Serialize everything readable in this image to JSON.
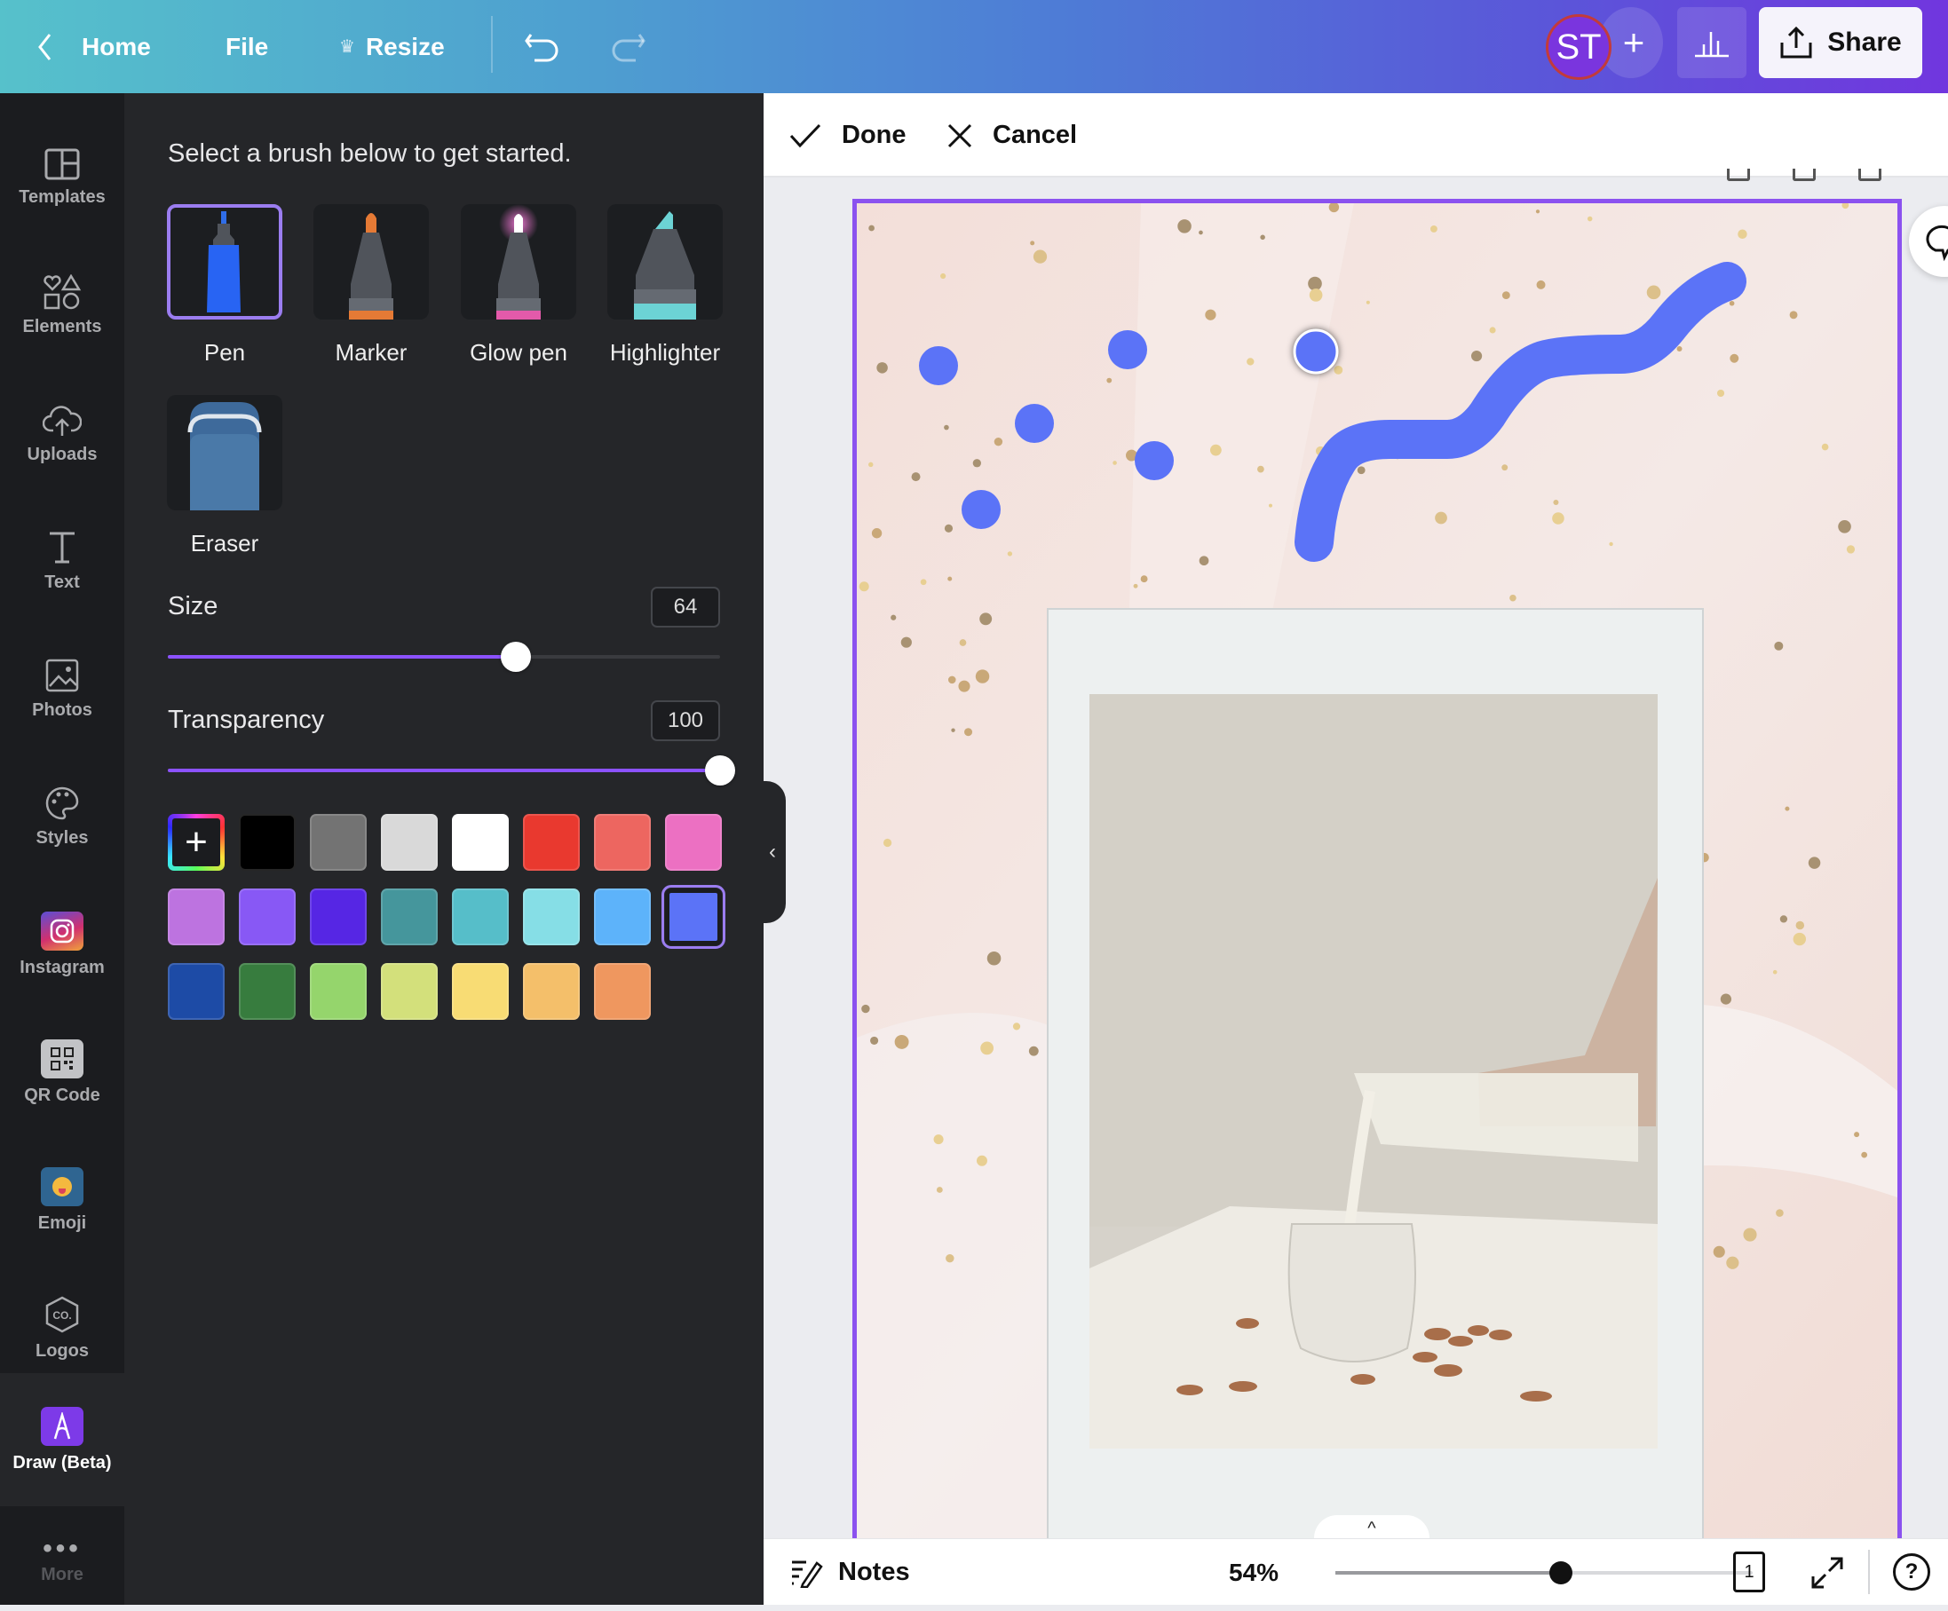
{
  "topbar": {
    "home_label": "Home",
    "file_label": "File",
    "resize_label": "Resize",
    "avatar_initials": "ST",
    "add_member_label": "+",
    "share_label": "Share"
  },
  "rail": {
    "items": [
      {
        "label": "Templates",
        "icon": "templates-icon"
      },
      {
        "label": "Elements",
        "icon": "elements-icon"
      },
      {
        "label": "Uploads",
        "icon": "uploads-icon"
      },
      {
        "label": "Text",
        "icon": "text-icon"
      },
      {
        "label": "Photos",
        "icon": "photos-icon"
      },
      {
        "label": "Styles",
        "icon": "styles-icon"
      },
      {
        "label": "Instagram",
        "icon": "instagram-icon"
      },
      {
        "label": "QR Code",
        "icon": "qr-code-icon"
      },
      {
        "label": "Emoji",
        "icon": "emoji-icon"
      },
      {
        "label": "Logos",
        "icon": "logos-icon"
      },
      {
        "label": "Draw (Beta)",
        "icon": "draw-icon",
        "active": true
      },
      {
        "label": "More",
        "icon": "more-icon"
      }
    ]
  },
  "panel": {
    "hint": "Select a brush below to get started.",
    "brushes": [
      {
        "label": "Pen",
        "selected": true
      },
      {
        "label": "Marker"
      },
      {
        "label": "Glow pen"
      },
      {
        "label": "Highlighter"
      },
      {
        "label": "Eraser"
      }
    ],
    "size": {
      "label": "Size",
      "value": "64",
      "fraction": 0.63
    },
    "transparency": {
      "label": "Transparency",
      "value": "100",
      "fraction": 1.0
    },
    "add_color_label": "+",
    "colors": [
      "#000000",
      "#737373",
      "#d9d9d9",
      "#ffffff",
      "#e9392f",
      "#ed6660",
      "#ec70c2",
      "#bd73e0",
      "#8858f5",
      "#5626e4",
      "#45969c",
      "#56bec9",
      "#86dee6",
      "#5db3fa",
      "#5b73f7",
      "#1d4ba6",
      "#377c3e",
      "#95d56c",
      "#d3e07b",
      "#f8dc74",
      "#f4bf6a",
      "#ef975f"
    ],
    "selected_color": "#5b73f7"
  },
  "editbar": {
    "done_label": "Done",
    "cancel_label": "Cancel"
  },
  "canvas": {
    "stroke_color": "#5b73f7",
    "accent_border": "#8b52ef"
  },
  "bottombar": {
    "notes_label": "Notes",
    "zoom_label": "54%",
    "zoom_fraction": 0.54,
    "page_count": "1",
    "help_label": "?"
  }
}
